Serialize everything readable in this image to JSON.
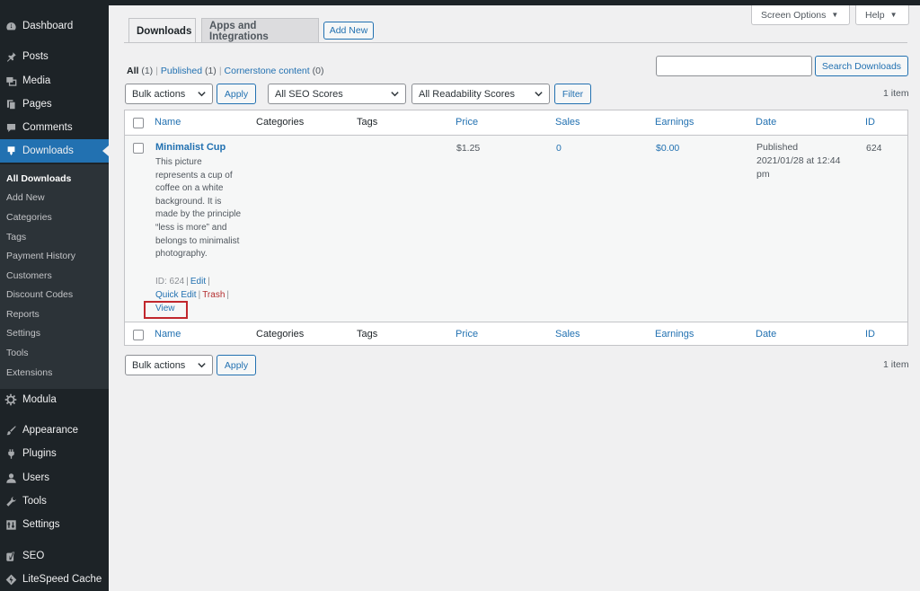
{
  "sidebar": {
    "items": [
      {
        "key": "dashboard",
        "label": "Dashboard",
        "icon": "dashboard-icon"
      },
      {
        "key": "posts",
        "label": "Posts",
        "icon": "pin-icon"
      },
      {
        "key": "media",
        "label": "Media",
        "icon": "media-icon"
      },
      {
        "key": "pages",
        "label": "Pages",
        "icon": "pages-icon"
      },
      {
        "key": "comments",
        "label": "Comments",
        "icon": "comment-icon"
      },
      {
        "key": "downloads",
        "label": "Downloads",
        "icon": "download-icon"
      },
      {
        "key": "modula",
        "label": "Modula",
        "icon": "gear-icon"
      },
      {
        "key": "appearance",
        "label": "Appearance",
        "icon": "brush-icon"
      },
      {
        "key": "plugins",
        "label": "Plugins",
        "icon": "plugin-icon"
      },
      {
        "key": "users",
        "label": "Users",
        "icon": "user-icon"
      },
      {
        "key": "tools",
        "label": "Tools",
        "icon": "wrench-icon"
      },
      {
        "key": "settings",
        "label": "Settings",
        "icon": "settings-icon"
      },
      {
        "key": "seo",
        "label": "SEO",
        "icon": "yoast-icon"
      },
      {
        "key": "litespeed",
        "label": "LiteSpeed Cache",
        "icon": "diamond-icon"
      }
    ],
    "submenu": [
      "All Downloads",
      "Add New",
      "Categories",
      "Tags",
      "Payment History",
      "Customers",
      "Discount Codes",
      "Reports",
      "Settings",
      "Tools",
      "Extensions"
    ]
  },
  "top": {
    "screen_options": "Screen Options",
    "help": "Help"
  },
  "tabs": {
    "downloads": "Downloads",
    "apps": "Apps and Integrations",
    "add_new": "Add New"
  },
  "views": {
    "all": "All",
    "all_count": "(1)",
    "published": "Published",
    "published_count": "(1)",
    "cornerstone": "Cornerstone content",
    "cornerstone_count": "(0)"
  },
  "search": {
    "value": "",
    "button": "Search Downloads"
  },
  "filters": {
    "bulk_actions": "Bulk actions",
    "apply": "Apply",
    "seo_scores": "All SEO Scores",
    "readability": "All Readability Scores",
    "filter": "Filter",
    "items_count": "1 item"
  },
  "table": {
    "columns": [
      "Name",
      "Categories",
      "Tags",
      "Price",
      "Sales",
      "Earnings",
      "Date",
      "ID"
    ],
    "row": {
      "title": "Minimalist Cup",
      "description": "This picture represents a cup of coffee on a white background. It is made by the principle “less is more” and belongs to minimalist photography.",
      "id_label": "ID: 624",
      "edit": "Edit",
      "quick_edit": "Quick Edit",
      "trash": "Trash",
      "view": "View",
      "price": "$1.25",
      "sales": "0",
      "earnings": "$0.00",
      "date_status": "Published",
      "date_line1": "2021/01/28 at 12:44",
      "date_line2": "pm",
      "id": "624"
    }
  },
  "bottom": {
    "bulk_actions": "Bulk actions",
    "apply": "Apply",
    "items_count": "1 item"
  },
  "colors": {
    "sidebar_bg": "#1d2327",
    "accent": "#2271b1",
    "trash": "#b32d2e",
    "highlight_box": "#c1272d"
  }
}
